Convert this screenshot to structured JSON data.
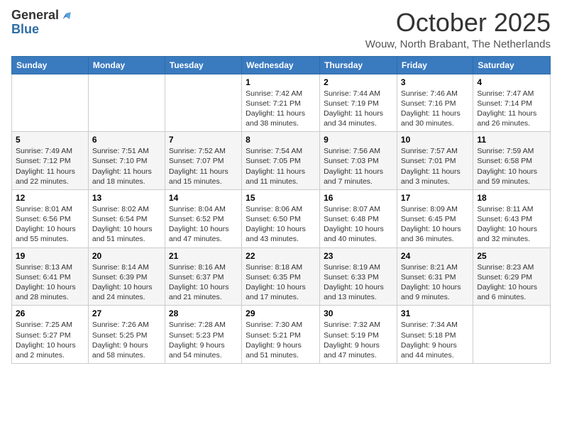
{
  "header": {
    "logo_general": "General",
    "logo_blue": "Blue",
    "main_title": "October 2025",
    "sub_title": "Wouw, North Brabant, The Netherlands"
  },
  "days_of_week": [
    "Sunday",
    "Monday",
    "Tuesday",
    "Wednesday",
    "Thursday",
    "Friday",
    "Saturday"
  ],
  "weeks": [
    {
      "days": [
        {
          "num": "",
          "info": ""
        },
        {
          "num": "",
          "info": ""
        },
        {
          "num": "",
          "info": ""
        },
        {
          "num": "1",
          "info": "Sunrise: 7:42 AM\nSunset: 7:21 PM\nDaylight: 11 hours\nand 38 minutes."
        },
        {
          "num": "2",
          "info": "Sunrise: 7:44 AM\nSunset: 7:19 PM\nDaylight: 11 hours\nand 34 minutes."
        },
        {
          "num": "3",
          "info": "Sunrise: 7:46 AM\nSunset: 7:16 PM\nDaylight: 11 hours\nand 30 minutes."
        },
        {
          "num": "4",
          "info": "Sunrise: 7:47 AM\nSunset: 7:14 PM\nDaylight: 11 hours\nand 26 minutes."
        }
      ]
    },
    {
      "days": [
        {
          "num": "5",
          "info": "Sunrise: 7:49 AM\nSunset: 7:12 PM\nDaylight: 11 hours\nand 22 minutes."
        },
        {
          "num": "6",
          "info": "Sunrise: 7:51 AM\nSunset: 7:10 PM\nDaylight: 11 hours\nand 18 minutes."
        },
        {
          "num": "7",
          "info": "Sunrise: 7:52 AM\nSunset: 7:07 PM\nDaylight: 11 hours\nand 15 minutes."
        },
        {
          "num": "8",
          "info": "Sunrise: 7:54 AM\nSunset: 7:05 PM\nDaylight: 11 hours\nand 11 minutes."
        },
        {
          "num": "9",
          "info": "Sunrise: 7:56 AM\nSunset: 7:03 PM\nDaylight: 11 hours\nand 7 minutes."
        },
        {
          "num": "10",
          "info": "Sunrise: 7:57 AM\nSunset: 7:01 PM\nDaylight: 11 hours\nand 3 minutes."
        },
        {
          "num": "11",
          "info": "Sunrise: 7:59 AM\nSunset: 6:58 PM\nDaylight: 10 hours\nand 59 minutes."
        }
      ]
    },
    {
      "days": [
        {
          "num": "12",
          "info": "Sunrise: 8:01 AM\nSunset: 6:56 PM\nDaylight: 10 hours\nand 55 minutes."
        },
        {
          "num": "13",
          "info": "Sunrise: 8:02 AM\nSunset: 6:54 PM\nDaylight: 10 hours\nand 51 minutes."
        },
        {
          "num": "14",
          "info": "Sunrise: 8:04 AM\nSunset: 6:52 PM\nDaylight: 10 hours\nand 47 minutes."
        },
        {
          "num": "15",
          "info": "Sunrise: 8:06 AM\nSunset: 6:50 PM\nDaylight: 10 hours\nand 43 minutes."
        },
        {
          "num": "16",
          "info": "Sunrise: 8:07 AM\nSunset: 6:48 PM\nDaylight: 10 hours\nand 40 minutes."
        },
        {
          "num": "17",
          "info": "Sunrise: 8:09 AM\nSunset: 6:45 PM\nDaylight: 10 hours\nand 36 minutes."
        },
        {
          "num": "18",
          "info": "Sunrise: 8:11 AM\nSunset: 6:43 PM\nDaylight: 10 hours\nand 32 minutes."
        }
      ]
    },
    {
      "days": [
        {
          "num": "19",
          "info": "Sunrise: 8:13 AM\nSunset: 6:41 PM\nDaylight: 10 hours\nand 28 minutes."
        },
        {
          "num": "20",
          "info": "Sunrise: 8:14 AM\nSunset: 6:39 PM\nDaylight: 10 hours\nand 24 minutes."
        },
        {
          "num": "21",
          "info": "Sunrise: 8:16 AM\nSunset: 6:37 PM\nDaylight: 10 hours\nand 21 minutes."
        },
        {
          "num": "22",
          "info": "Sunrise: 8:18 AM\nSunset: 6:35 PM\nDaylight: 10 hours\nand 17 minutes."
        },
        {
          "num": "23",
          "info": "Sunrise: 8:19 AM\nSunset: 6:33 PM\nDaylight: 10 hours\nand 13 minutes."
        },
        {
          "num": "24",
          "info": "Sunrise: 8:21 AM\nSunset: 6:31 PM\nDaylight: 10 hours\nand 9 minutes."
        },
        {
          "num": "25",
          "info": "Sunrise: 8:23 AM\nSunset: 6:29 PM\nDaylight: 10 hours\nand 6 minutes."
        }
      ]
    },
    {
      "days": [
        {
          "num": "26",
          "info": "Sunrise: 7:25 AM\nSunset: 5:27 PM\nDaylight: 10 hours\nand 2 minutes."
        },
        {
          "num": "27",
          "info": "Sunrise: 7:26 AM\nSunset: 5:25 PM\nDaylight: 9 hours\nand 58 minutes."
        },
        {
          "num": "28",
          "info": "Sunrise: 7:28 AM\nSunset: 5:23 PM\nDaylight: 9 hours\nand 54 minutes."
        },
        {
          "num": "29",
          "info": "Sunrise: 7:30 AM\nSunset: 5:21 PM\nDaylight: 9 hours\nand 51 minutes."
        },
        {
          "num": "30",
          "info": "Sunrise: 7:32 AM\nSunset: 5:19 PM\nDaylight: 9 hours\nand 47 minutes."
        },
        {
          "num": "31",
          "info": "Sunrise: 7:34 AM\nSunset: 5:18 PM\nDaylight: 9 hours\nand 44 minutes."
        },
        {
          "num": "",
          "info": ""
        }
      ]
    }
  ]
}
